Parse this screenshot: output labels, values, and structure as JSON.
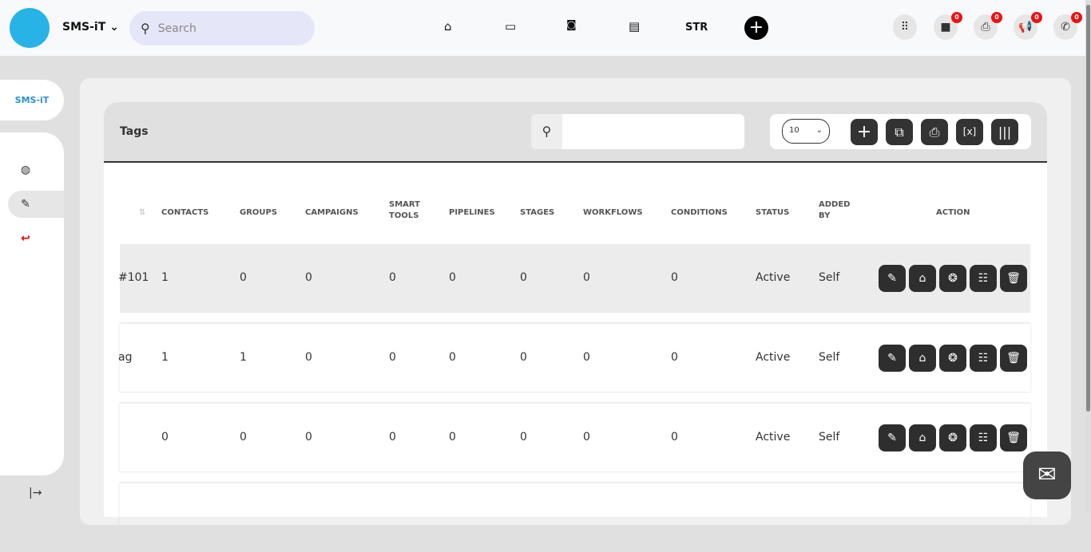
{
  "topbar": {
    "brand": "SMS-iT",
    "search_placeholder": "Search",
    "nav": [
      {
        "icon": "home-icon",
        "glyph": "⌂"
      },
      {
        "icon": "monitor-icon",
        "glyph": "▭"
      },
      {
        "icon": "robot-icon",
        "glyph": "🤖"
      },
      {
        "icon": "store-icon",
        "glyph": "▤"
      }
    ],
    "str_label": "STR",
    "badges": {
      "messages": "0",
      "printer": "0",
      "announcements": "0",
      "calls": "0"
    }
  },
  "sidebar": {
    "logo_text": "SMS-iT",
    "collapse_glyph": "|→"
  },
  "card": {
    "title": "Tags",
    "page_size": "10"
  },
  "table": {
    "headers": [
      "CONTACTS",
      "GROUPS",
      "CAMPAIGNS",
      "SMART TOOLS",
      "PIPELINES",
      "STAGES",
      "WORKFLOWS",
      "CONDITIONS",
      "STATUS",
      "ADDED BY",
      "ACTION"
    ],
    "rows": [
      {
        "name": "#101",
        "cells": [
          "1",
          "0",
          "0",
          "0",
          "0",
          "0",
          "0",
          "0",
          "Active",
          "Self"
        ]
      },
      {
        "name": "ag",
        "cells": [
          "1",
          "1",
          "0",
          "0",
          "0",
          "0",
          "0",
          "0",
          "Active",
          "Self"
        ]
      },
      {
        "name": "",
        "cells": [
          "0",
          "0",
          "0",
          "0",
          "0",
          "0",
          "0",
          "0",
          "Active",
          "Self"
        ]
      }
    ]
  },
  "colors": {
    "accent": "#27b3e6",
    "badge": "#e11111",
    "button": "#333333"
  }
}
